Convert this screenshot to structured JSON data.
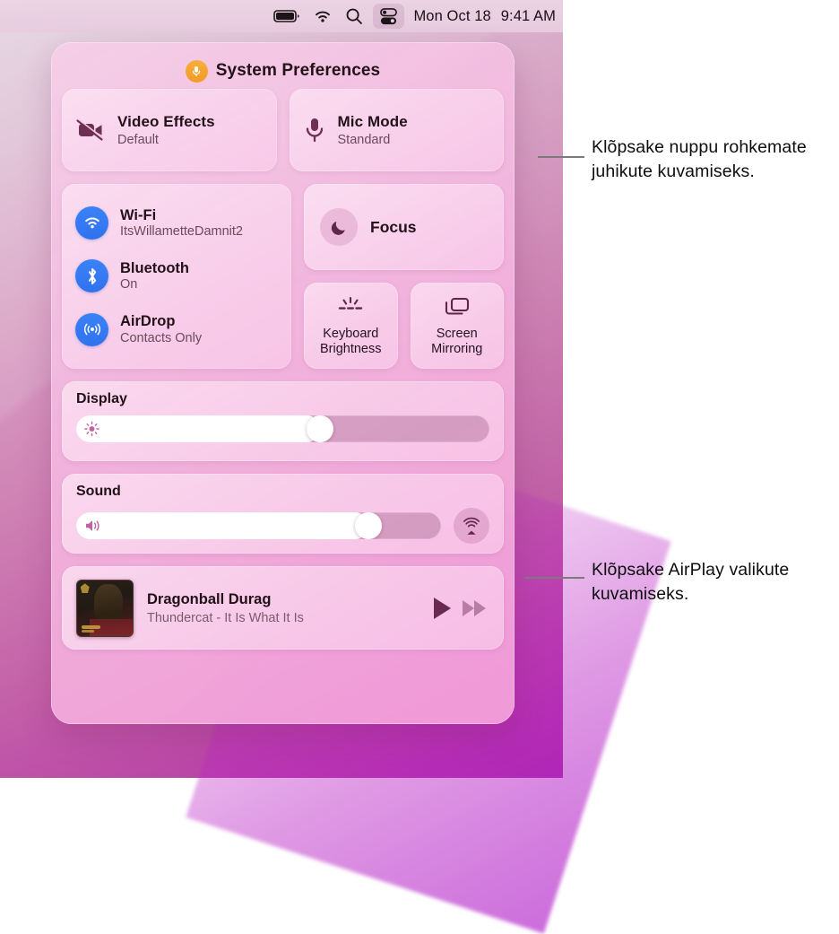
{
  "menubar": {
    "icons": [
      "battery-icon",
      "wifi-icon",
      "search-icon",
      "control-center-icon"
    ],
    "date": "Mon Oct 18",
    "time": "9:41 AM"
  },
  "control_center": {
    "title": "System Preferences",
    "title_badge_icon": "microphone-badge-icon",
    "tiles": [
      {
        "icon": "video-off-icon",
        "title": "Video Effects",
        "subtitle": "Default"
      },
      {
        "icon": "microphone-icon",
        "title": "Mic Mode",
        "subtitle": "Standard"
      }
    ],
    "connectivity": [
      {
        "icon": "wifi-icon",
        "title": "Wi-Fi",
        "subtitle": "ItsWillametteDamnit2"
      },
      {
        "icon": "bluetooth-icon",
        "title": "Bluetooth",
        "subtitle": "On"
      },
      {
        "icon": "airdrop-icon",
        "title": "AirDrop",
        "subtitle": "Contacts Only"
      }
    ],
    "focus": {
      "icon": "moon-icon",
      "label": "Focus"
    },
    "squares": [
      {
        "icon": "keyboard-brightness-icon",
        "label": "Keyboard\nBrightness",
        "line1": "Keyboard",
        "line2": "Brightness"
      },
      {
        "icon": "screen-mirroring-icon",
        "label": "Screen\nMirroring",
        "line1": "Screen",
        "line2": "Mirroring"
      }
    ],
    "display": {
      "label": "Display",
      "icon": "brightness-icon",
      "value": 59
    },
    "sound": {
      "label": "Sound",
      "icon": "speaker-icon",
      "value": 80,
      "airplay_icon": "airplay-audio-icon"
    },
    "now_playing": {
      "title": "Dragonball Durag",
      "subtitle": "Thundercat - It Is What It Is",
      "artwork": "album-artwork",
      "play_icon": "play-icon",
      "forward_icon": "fast-forward-icon"
    }
  },
  "callouts": [
    {
      "text": "Klõpsake nuppu rohkemate juhikute kuvamiseks."
    },
    {
      "text": "Klõpsake AirPlay valikute kuvamiseks."
    }
  ],
  "colors": {
    "accent_blue": "#3b82f6",
    "badge_orange": "#f2a02c",
    "panel_pink": "#f6cee8",
    "icon_plum": "#6e2f52"
  }
}
